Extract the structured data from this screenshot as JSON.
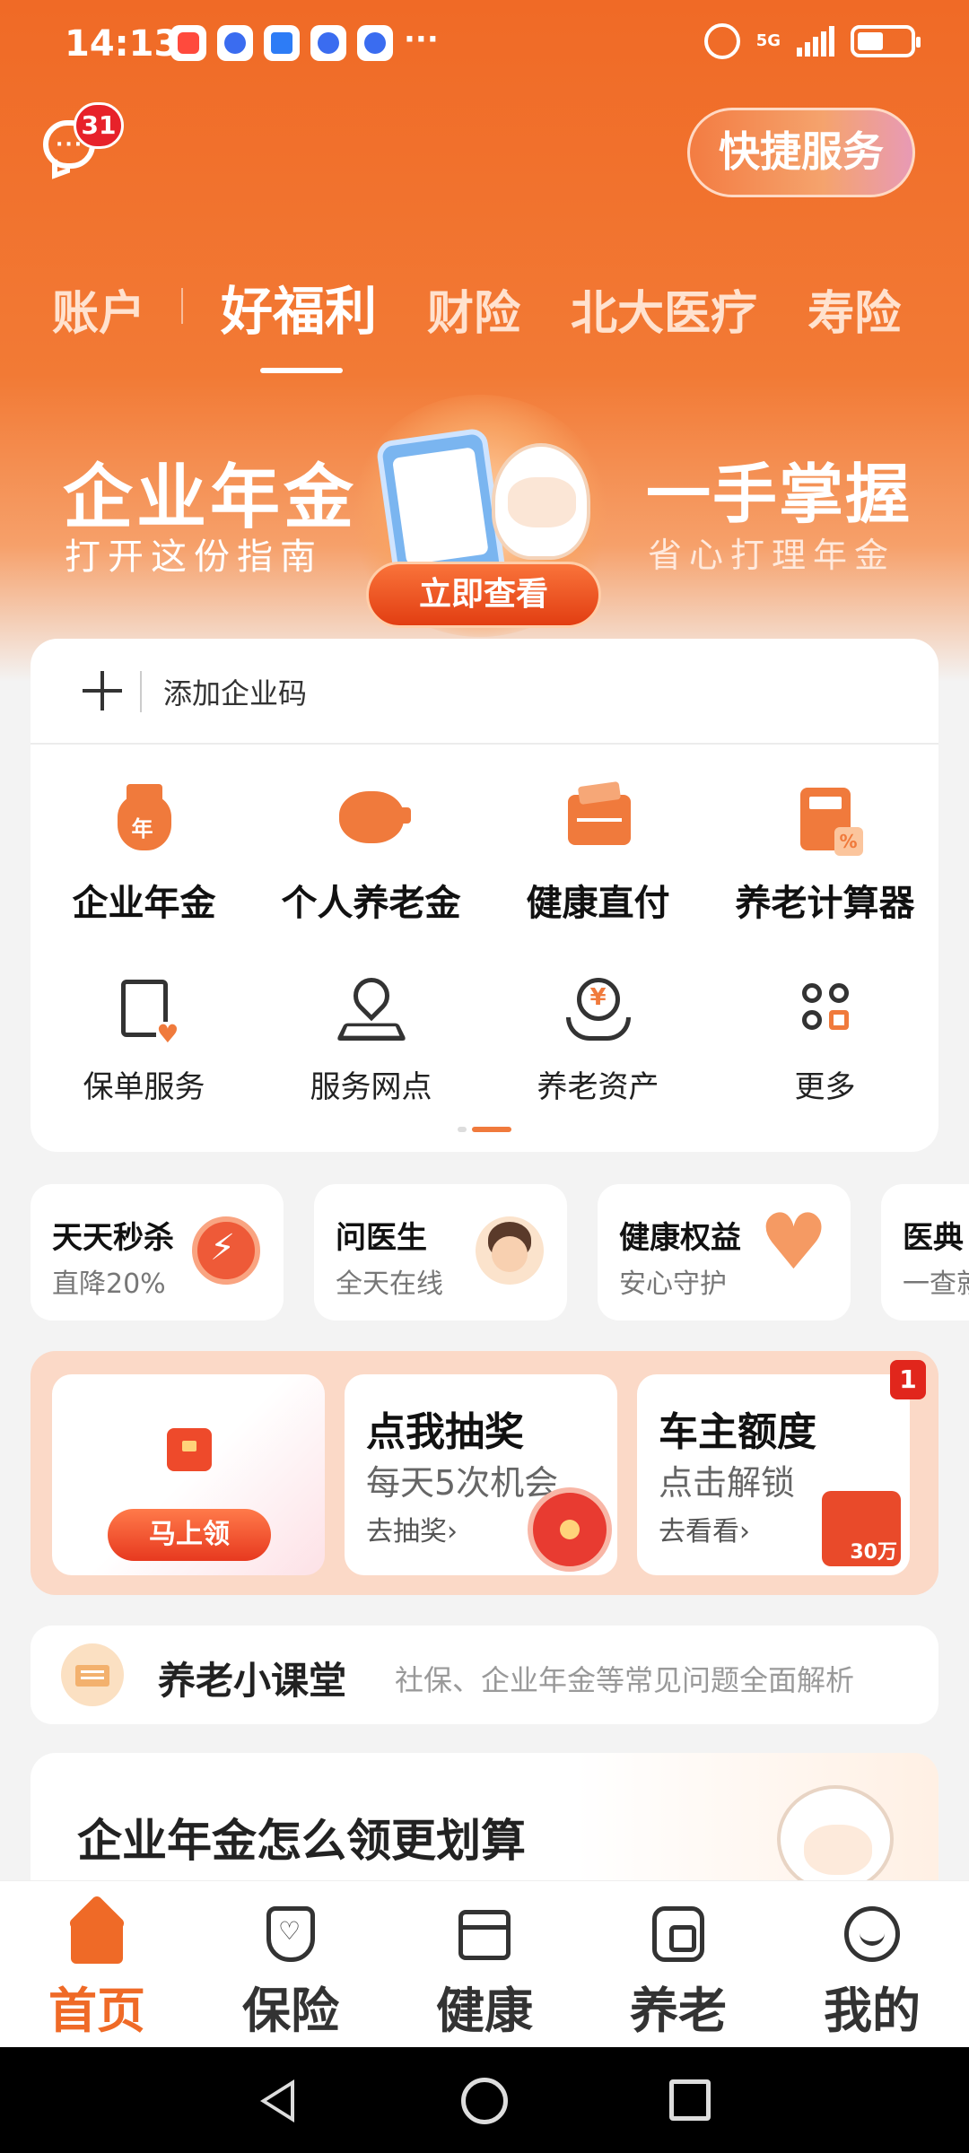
{
  "status_bar": {
    "time": "14:13",
    "network": "5G",
    "notification_icons": [
      "douyin-icon",
      "app-icon",
      "huawei-app-icon",
      "app-icon",
      "app-icon"
    ],
    "more": "···"
  },
  "header": {
    "message_badge": "31",
    "quick_service_label": "快捷服务"
  },
  "tabs": [
    {
      "label": "账户",
      "active": false
    },
    {
      "label": "好福利",
      "active": true
    },
    {
      "label": "财险",
      "active": false
    },
    {
      "label": "北大医疗",
      "active": false
    },
    {
      "label": "寿险",
      "active": false
    }
  ],
  "banner": {
    "left_title": "企业年金",
    "left_subtitle": "打开这份指南",
    "right_title": "一手掌握",
    "right_subtitle": "省心打理年金",
    "cta": "立即查看"
  },
  "enterprise_code": {
    "label": "添加企业码"
  },
  "grid_primary": [
    {
      "label": "企业年金",
      "icon": "money-bag-icon"
    },
    {
      "label": "个人养老金",
      "icon": "piggy-bank-icon"
    },
    {
      "label": "健康直付",
      "icon": "wallet-icon"
    },
    {
      "label": "养老计算器",
      "icon": "calculator-icon"
    }
  ],
  "grid_secondary": [
    {
      "label": "保单服务",
      "icon": "policy-doc-icon"
    },
    {
      "label": "服务网点",
      "icon": "location-pin-icon"
    },
    {
      "label": "养老资产",
      "icon": "coin-hand-icon"
    },
    {
      "label": "更多",
      "icon": "more-grid-icon"
    }
  ],
  "mini_cards": [
    {
      "title": "天天秒杀",
      "subtitle": "直降20%",
      "icon": "alarm-clock-icon"
    },
    {
      "title": "问医生",
      "subtitle": "全天在线",
      "icon": "doctor-avatar-icon"
    },
    {
      "title": "健康权益",
      "subtitle": "安心守护",
      "icon": "heart-plus-icon"
    },
    {
      "title": "医典",
      "subtitle": "一查就",
      "icon": ""
    }
  ],
  "promo": {
    "card1": {
      "button": "马上领"
    },
    "card2": {
      "title": "点我抽奖",
      "subtitle": "每天5次机会",
      "link": "去抽奖›"
    },
    "card3": {
      "title": "车主额度",
      "subtitle": "点击解锁",
      "link": "去看看›",
      "badge": "1",
      "amount": "30万"
    }
  },
  "classroom": {
    "title": "养老小课堂",
    "description": "社保、企业年金等常见问题全面解析"
  },
  "article": {
    "title": "企业年金怎么领更划算"
  },
  "bottom_nav": [
    {
      "label": "首页",
      "active": true
    },
    {
      "label": "保险",
      "active": false
    },
    {
      "label": "健康",
      "active": false
    },
    {
      "label": "养老",
      "active": false
    },
    {
      "label": "我的",
      "active": false
    }
  ],
  "colors": {
    "brand_orange": "#f06a26",
    "badge_red": "#e7222a"
  }
}
